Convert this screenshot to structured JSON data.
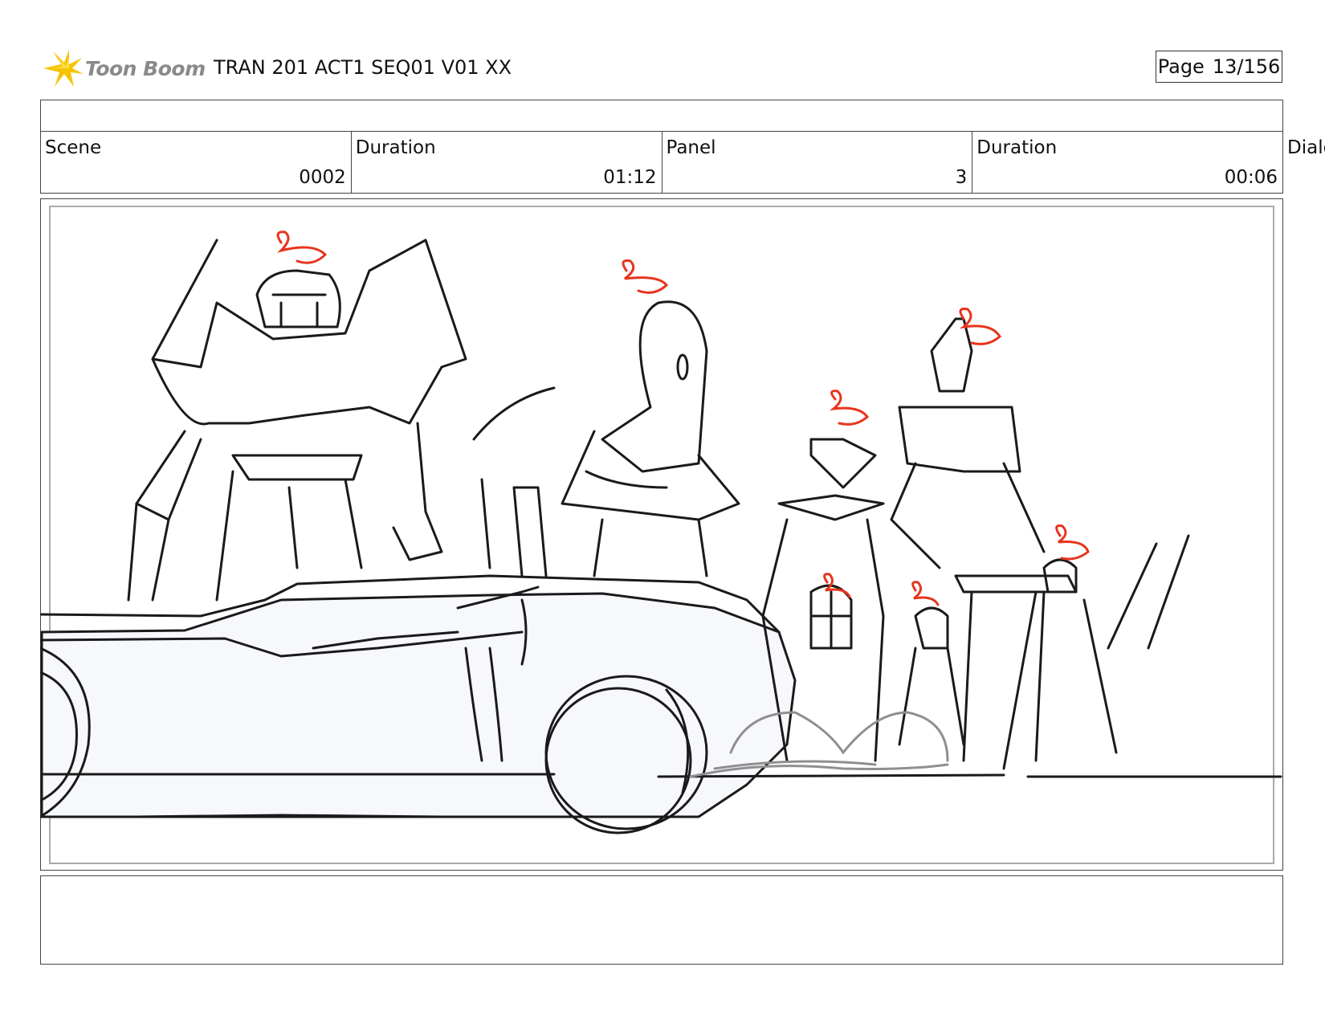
{
  "header": {
    "logo_text": "Toon Boom",
    "title": "TRAN 201 ACT1 SEQ01 V01 XX",
    "page_label": "Page",
    "page_value": "13/156"
  },
  "meta": {
    "scene_label": "Scene",
    "scene_value": "0002",
    "duration_label": "Duration",
    "duration_value": "01:12",
    "panel_label": "Panel",
    "panel_value": "3",
    "panel_duration_label": "Duration",
    "panel_duration_value": "00:06",
    "dialog_label": "Dialo"
  },
  "colors": {
    "sketch_line": "#1a1a1a",
    "annotation_red": "#e8341c",
    "car_fill": "#f6f8fc",
    "logo_yellow": "#f5c400",
    "logo_gray": "#8a8a8a"
  }
}
